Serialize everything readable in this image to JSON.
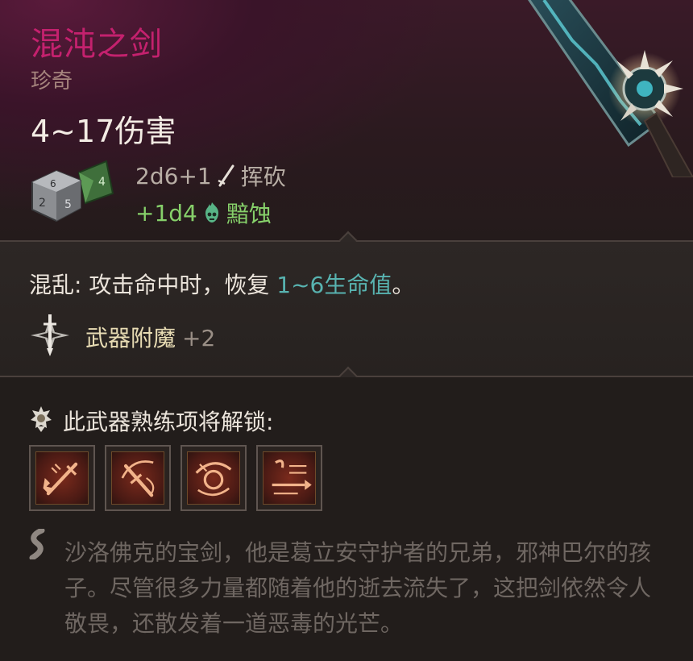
{
  "item": {
    "name": "混沌之剑",
    "rarity": "珍奇",
    "damage": "4~17伤害",
    "damage_lines": [
      {
        "formula": "2d6+1",
        "icon": "sword-icon",
        "type": "挥砍",
        "color": "#b8aea5"
      },
      {
        "formula": "+1d4",
        "icon": "skull-flame-icon",
        "type": "黯蚀",
        "color": "#86d06a"
      }
    ],
    "passive": {
      "name": "混乱",
      "separator": ":",
      "text": " 攻击命中时，恢复 ",
      "highlight": "1~6生命值",
      "end": "。",
      "highlight_color": "#58b3b0"
    },
    "enchantment": {
      "label": "武器附魔",
      "bonus": "+2",
      "icon": "enchant-icon"
    },
    "proficiency": {
      "label": "此武器熟练项将解锁:",
      "icon": "proficiency-medal-icon",
      "actions": [
        {
          "icon": "action-icon-1"
        },
        {
          "icon": "action-icon-2"
        },
        {
          "icon": "action-icon-3"
        },
        {
          "icon": "action-icon-4"
        }
      ]
    },
    "lore": "沙洛佛克的宝剑，他是葛立安守护者的兄弟，邪神巴尔的孩子。尽管很多力量都随着他的逝去流失了，这把剑依然令人敬畏，还散发着一道恶毒的光芒。"
  },
  "colors": {
    "name": "#c4216e",
    "rarity": "#a6857e",
    "damage": "#f3ece4",
    "enchant": "#e8dcb4",
    "lore": "#6f6762"
  }
}
